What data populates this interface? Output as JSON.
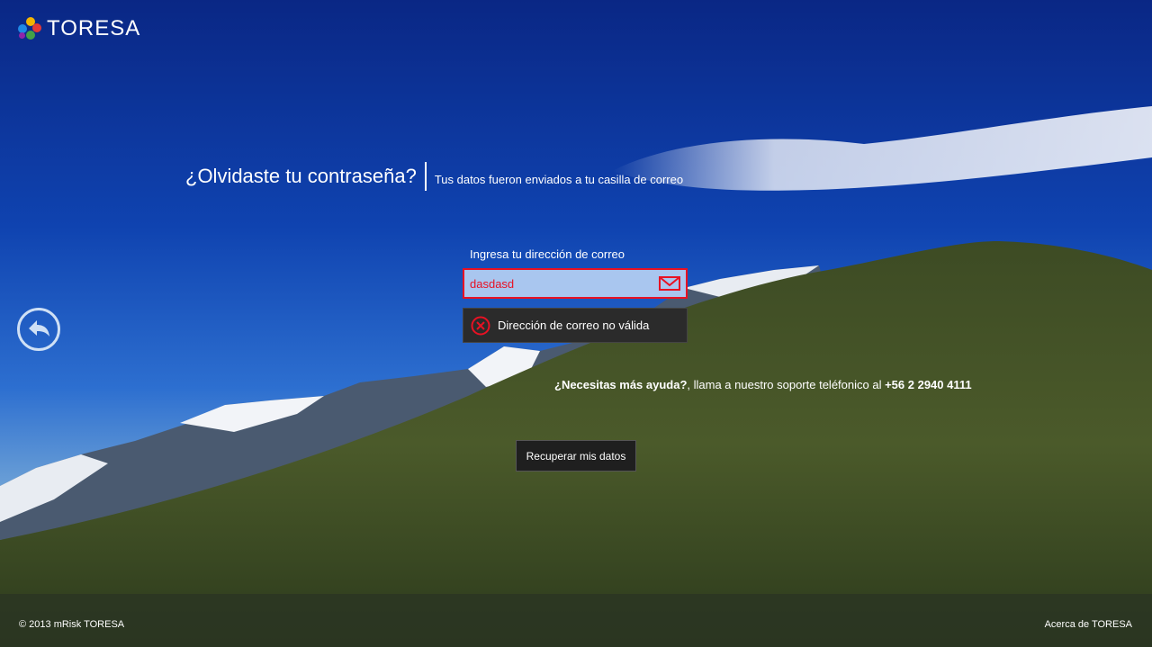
{
  "app": {
    "logo_text": "TORESA",
    "logo_colors": [
      "#1e88e5",
      "#f4b400",
      "#e53935",
      "#43a047",
      "#8e24aa"
    ]
  },
  "header": {
    "title": "¿Olvidaste tu contraseña?",
    "subtitle": "Tus datos fueron enviados a tu casilla de correo"
  },
  "form": {
    "email_label": "Ingresa tu dirección de correo",
    "email_value": "dasdasd",
    "error_message": "Dirección de correo no válida",
    "accent_error": "#e81123"
  },
  "help": {
    "prefix": "¿Necesitas más ayuda?",
    "middle": ", llama a nuestro soporte teléfonico al ",
    "phone": "+56 2 2940 4111"
  },
  "actions": {
    "recover_label": "Recuperar mis datos"
  },
  "footer": {
    "copyright": "© 2013 mRisk TORESA",
    "about": "Acerca de TORESA"
  },
  "icons": {
    "back": "back-arrow-icon",
    "mail": "mail-icon",
    "error": "error-circle-icon"
  }
}
